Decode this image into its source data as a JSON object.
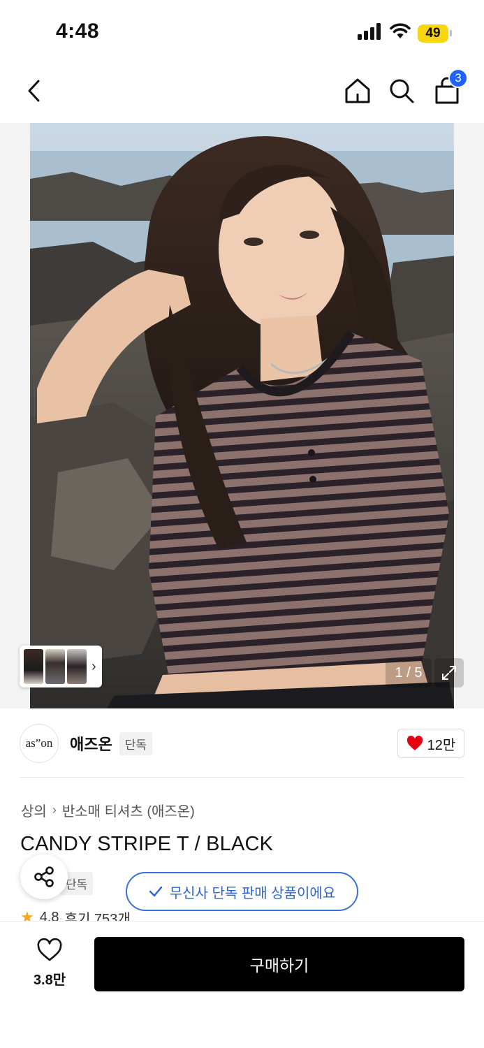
{
  "status_bar": {
    "time": "4:48",
    "battery": "49"
  },
  "nav": {
    "cart_count": "3"
  },
  "gallery": {
    "counter": "1 / 5"
  },
  "brand": {
    "logo_text": "as”on",
    "name": "애즈온",
    "exclusive_tag": "단독",
    "likes": "12만"
  },
  "breadcrumb": [
    "상의",
    "반소매 티셔츠 (애즈온)"
  ],
  "product": {
    "title": "CANDY STRIPE T / BLACK",
    "exclusive_tag": "단독"
  },
  "toast": {
    "text": "무신사 단독 판매 상품이에요"
  },
  "rating": {
    "score": "4.8",
    "reviews": "후기 753개"
  },
  "bottom": {
    "wish_count": "3.8만",
    "buy_label": "구매하기"
  },
  "colors": {
    "accent_blue": "#1f62ff",
    "heart_red": "#e60012",
    "battery_yellow": "#f7d511"
  }
}
